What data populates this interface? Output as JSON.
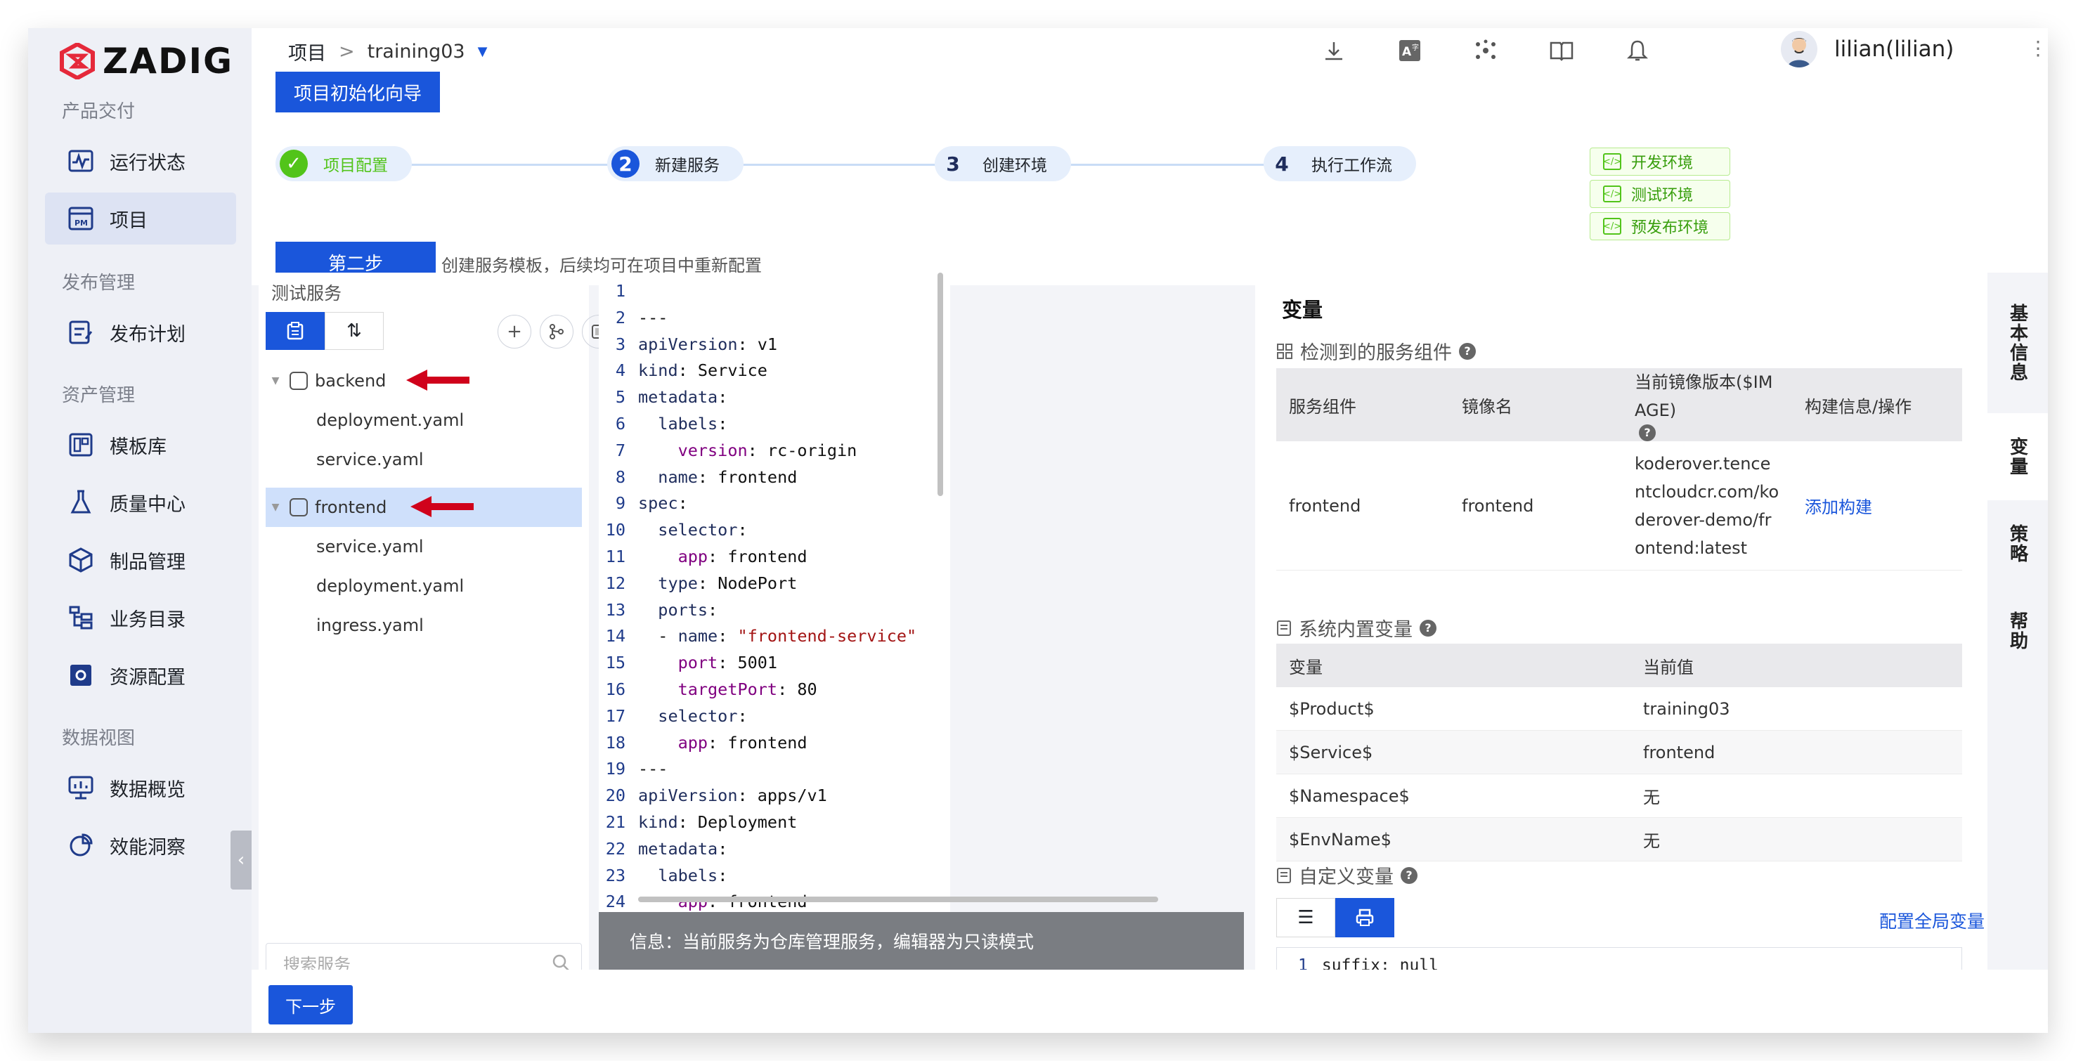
{
  "brand": {
    "name": "ZADIG",
    "accent": "#1a56db"
  },
  "sidebar": {
    "groups": [
      {
        "title": "产品交付",
        "items": [
          {
            "label": "运行状态",
            "icon": "pulse-icon"
          },
          {
            "label": "项目",
            "icon": "pm-icon",
            "active": true
          }
        ]
      },
      {
        "title": "发布管理",
        "items": [
          {
            "label": "发布计划",
            "icon": "plan-icon"
          }
        ]
      },
      {
        "title": "资产管理",
        "items": [
          {
            "label": "模板库",
            "icon": "template-icon"
          },
          {
            "label": "质量中心",
            "icon": "flask-icon"
          },
          {
            "label": "制品管理",
            "icon": "package-icon"
          },
          {
            "label": "业务目录",
            "icon": "catalog-icon"
          },
          {
            "label": "资源配置",
            "icon": "gear-icon"
          }
        ]
      },
      {
        "title": "数据视图",
        "items": [
          {
            "label": "数据概览",
            "icon": "monitor-icon"
          },
          {
            "label": "效能洞察",
            "icon": "pie-icon"
          }
        ]
      }
    ]
  },
  "header": {
    "breadcrumb_root": "项目",
    "breadcrumb_sep": ">",
    "project": "training03",
    "user": "lilian(lilian)"
  },
  "wizard": {
    "guide_label": "项目初始化向导",
    "steps": [
      {
        "num": "✓",
        "label": "项目配置",
        "state": "done"
      },
      {
        "num": "2",
        "label": "新建服务",
        "state": "current"
      },
      {
        "num": "3",
        "label": "创建环境",
        "state": "pending"
      },
      {
        "num": "4",
        "label": "执行工作流",
        "state": "pending"
      }
    ],
    "envs": [
      "开发环境",
      "测试环境",
      "预发布环境"
    ],
    "step_badge": "第二步",
    "step_desc": "创建服务模板，后续均可在项目中重新配置"
  },
  "services": {
    "title": "测试服务",
    "tree": [
      {
        "name": "backend",
        "selected": false,
        "children": [
          "deployment.yaml",
          "service.yaml"
        ]
      },
      {
        "name": "frontend",
        "selected": true,
        "children": [
          "service.yaml",
          "deployment.yaml",
          "ingress.yaml"
        ]
      }
    ],
    "search_placeholder": "搜索服务"
  },
  "editor": {
    "lines": [
      "",
      "---",
      "apiVersion: v1",
      "kind: Service",
      "metadata:",
      "  labels:",
      "    version: rc-origin",
      "  name: frontend",
      "spec:",
      "  selector:",
      "    app: frontend",
      "  type: NodePort",
      "  ports:",
      "  - name: \"frontend-service\"",
      "    port: 5001",
      "    targetPort: 80",
      "  selector:",
      "    app: frontend",
      "---",
      "apiVersion: apps/v1",
      "kind: Deployment",
      "metadata:",
      "  labels:",
      "    app: frontend"
    ],
    "info": "信息：当前服务为仓库管理服务，编辑器为只读模式"
  },
  "variables": {
    "title": "变量",
    "detected": {
      "title": "检测到的服务组件",
      "headers": [
        "服务组件",
        "镜像名",
        "当前镜像版本($IMAGE)",
        "构建信息/操作"
      ],
      "rows": [
        {
          "component": "frontend",
          "image": "frontend",
          "version": "koderover.tencentcloudcr.com/koderover-demo/frontend:latest",
          "action": "添加构建"
        }
      ]
    },
    "system": {
      "title": "系统内置变量",
      "headers": [
        "变量",
        "当前值"
      ],
      "rows": [
        {
          "name": "$Product$",
          "value": "training03"
        },
        {
          "name": "$Service$",
          "value": "frontend"
        },
        {
          "name": "$Namespace$",
          "value": "无"
        },
        {
          "name": "$EnvName$",
          "value": "无"
        }
      ]
    },
    "custom": {
      "title": "自定义变量",
      "config_link": "配置全局变量",
      "yaml_line": "suffix: null"
    }
  },
  "rail": {
    "tabs": [
      "基本信息",
      "变量",
      "策略",
      "帮助"
    ],
    "active": "变量"
  },
  "footer": {
    "next_label": "下一步"
  }
}
